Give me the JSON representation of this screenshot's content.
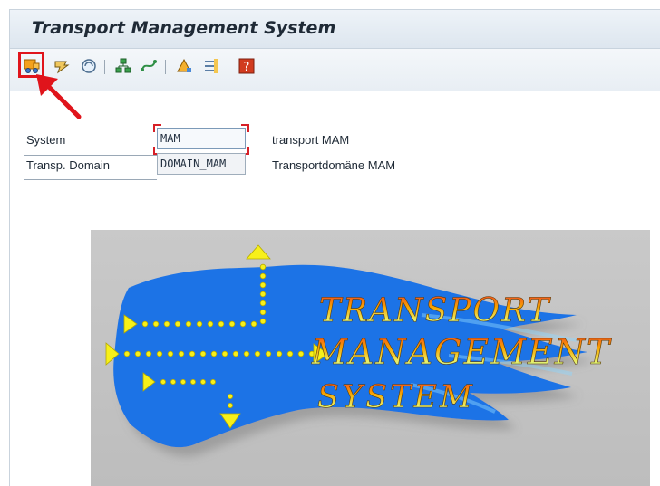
{
  "window": {
    "title": "Transport Management System"
  },
  "toolbar": {
    "buttons": [
      {
        "name": "transport-routes-icon",
        "glyph": "▶",
        "highlighted": true
      },
      {
        "name": "import-overview-icon",
        "glyph": "≋"
      },
      {
        "name": "refresh-icon",
        "glyph": "◎"
      },
      {
        "name": "system-overview-icon",
        "glyph": "▣"
      },
      {
        "name": "transport-routes-graph-icon",
        "glyph": "⟲"
      },
      {
        "name": "alert-monitor-icon",
        "glyph": "▲"
      },
      {
        "name": "settings-icon",
        "glyph": "≡"
      },
      {
        "name": "help-icon",
        "glyph": "?"
      }
    ]
  },
  "form": {
    "system_label": "System",
    "system_value": "MAM",
    "system_description": "transport MAM",
    "domain_label": "Transp. Domain",
    "domain_value": "DOMAIN_MAM",
    "domain_description": "Transportdomäne MAM"
  },
  "logo": {
    "line1": "TRANSPORT",
    "line2": "MANAGEMENT",
    "line3": "SYSTEM"
  },
  "colors": {
    "accent_red": "#e0141b",
    "logo_blue": "#1f73e6",
    "logo_yellow": "#f6ef13",
    "logo_background": "#c4c4c4"
  }
}
